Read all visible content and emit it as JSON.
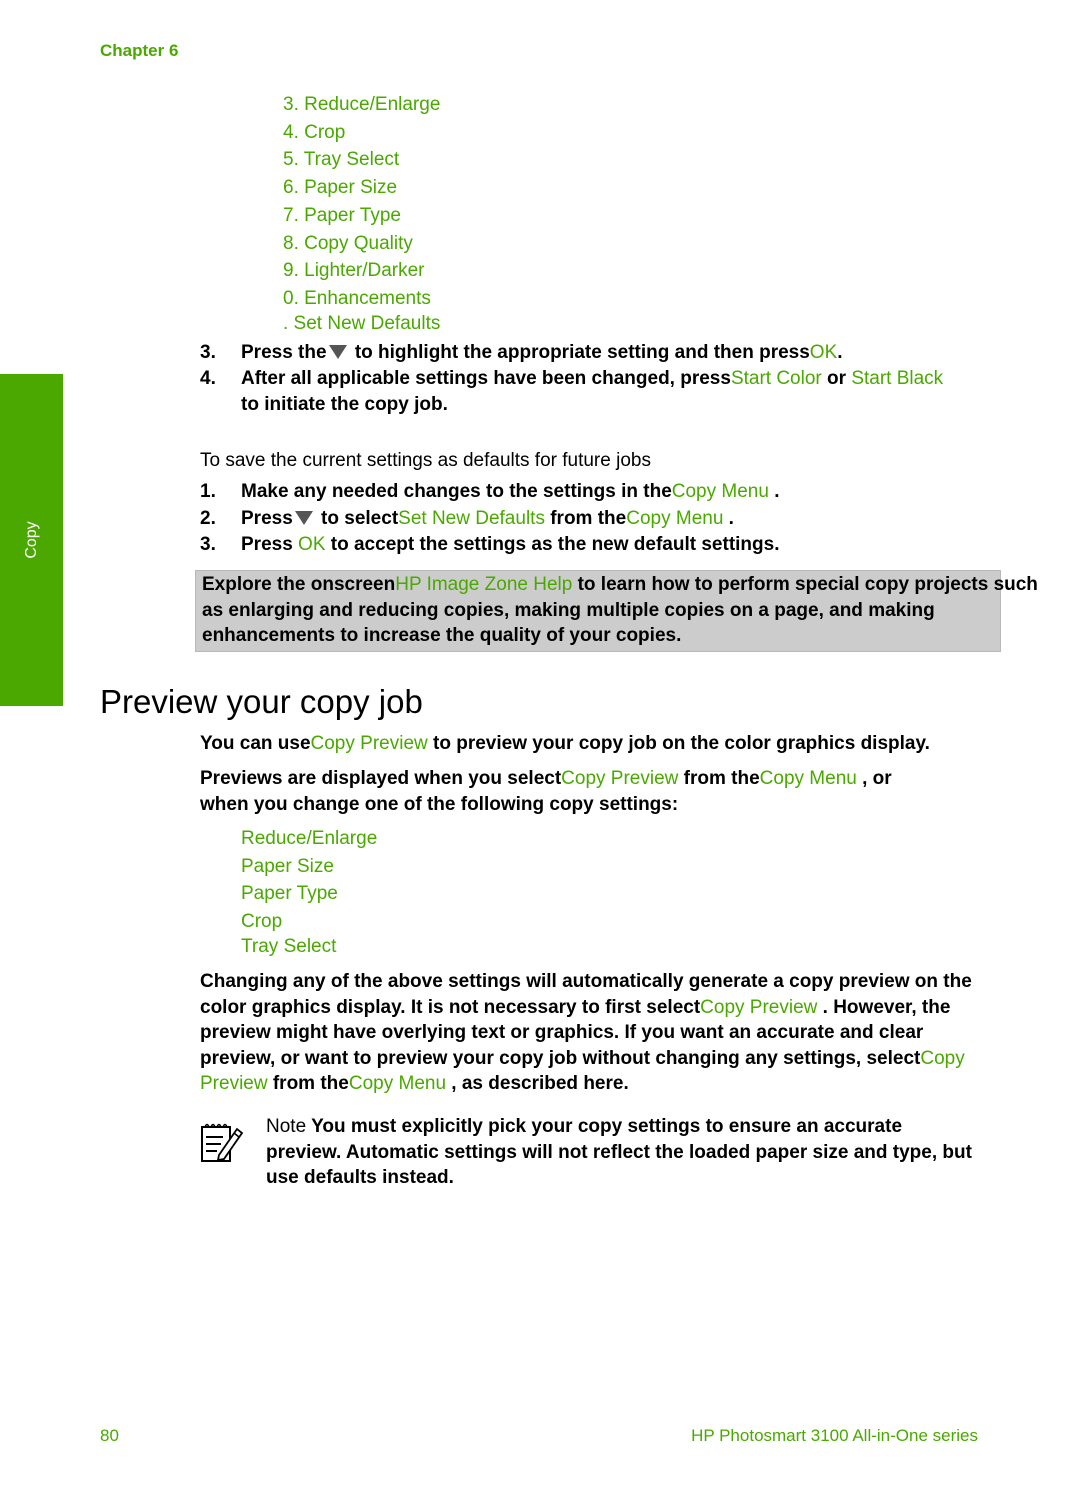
{
  "header": {
    "chapter": "Chapter 6"
  },
  "side_tab": {
    "label": "Copy"
  },
  "copy_menu_items": [
    "3. Reduce/Enlarge",
    "4. Crop",
    "5. Tray Select",
    "6. Paper Size",
    "7. Paper Type",
    "8. Copy Quality",
    "9. Lighter/Darker",
    "0. Enhancements",
    ". Set New Defaults"
  ],
  "steps_a": [
    {
      "num": "3.",
      "pre": "Press the",
      "icon": "down-arrow-icon",
      "mid": " to highlight the appropriate setting and then press",
      "link": "OK",
      "post": "."
    },
    {
      "num": "4.",
      "pre": "After all applicable settings have been changed, press",
      "link1": "Start Color",
      "mid": " or ",
      "link2": "Start Black",
      "line2": "to initiate the copy job."
    }
  ],
  "save_defaults": {
    "intro": "To save the current settings as defaults for future jobs",
    "steps": [
      {
        "num": "1.",
        "pre": "Make any needed changes to the settings in the",
        "link": "Copy Menu",
        "post": " ."
      },
      {
        "num": "2.",
        "pre": "Press",
        "icon": "down-arrow-icon",
        "mid": " to select",
        "link1": "Set New Defaults",
        "mid2": "  from the",
        "link2": "Copy Menu",
        "post": " ."
      },
      {
        "num": "3.",
        "pre": "Press ",
        "link": "OK",
        "post": " to accept the settings as the new default settings."
      }
    ]
  },
  "tip": {
    "pre": "Explore the onscreen",
    "link": "HP Image Zone Help",
    "post": "  to learn how to perform special copy projects such as enlarging and reducing copies, making multiple copies on a page, and making enhancements to increase the quality of your copies."
  },
  "section": {
    "title": "Preview your copy job",
    "p1": {
      "pre": "You can use",
      "link": "Copy Preview",
      "post": "  to preview your copy job on the color graphics display."
    },
    "p2": {
      "pre": "Previews are displayed when you select",
      "link1": "Copy Preview",
      "mid": "  from the",
      "link2": "Copy Menu",
      "post": " , or",
      "line2": "when you change one of the following copy settings:"
    },
    "settings": [
      "Reduce/Enlarge",
      "Paper Size",
      "Paper Type",
      "Crop",
      "Tray Select"
    ],
    "p3": {
      "l1": "Changing any of the above settings will automatically generate a copy preview on the",
      "l2_pre": "color graphics display. It is not necessary to first select",
      "l2_link": "Copy Preview",
      "l2_post": " . However, the",
      "l3": "preview might have overlying text or graphics. If you want an accurate and clear",
      "l4_pre": "preview, or want to preview your copy job without changing any settings, select",
      "l4_link": "Copy",
      "l5_link1": "Preview",
      "l5_mid": "  from the",
      "l5_link2": "Copy Menu",
      "l5_post": " , as described here."
    },
    "note": {
      "label": "Note",
      "l1": "  You must explicitly pick your copy settings to ensure an accurate",
      "l2": "preview. Automatic settings will not reflect the loaded paper size and type, but",
      "l3": "use defaults instead."
    }
  },
  "footer": {
    "page_number": "80",
    "product": "HP Photosmart 3100 All-in-One series"
  }
}
